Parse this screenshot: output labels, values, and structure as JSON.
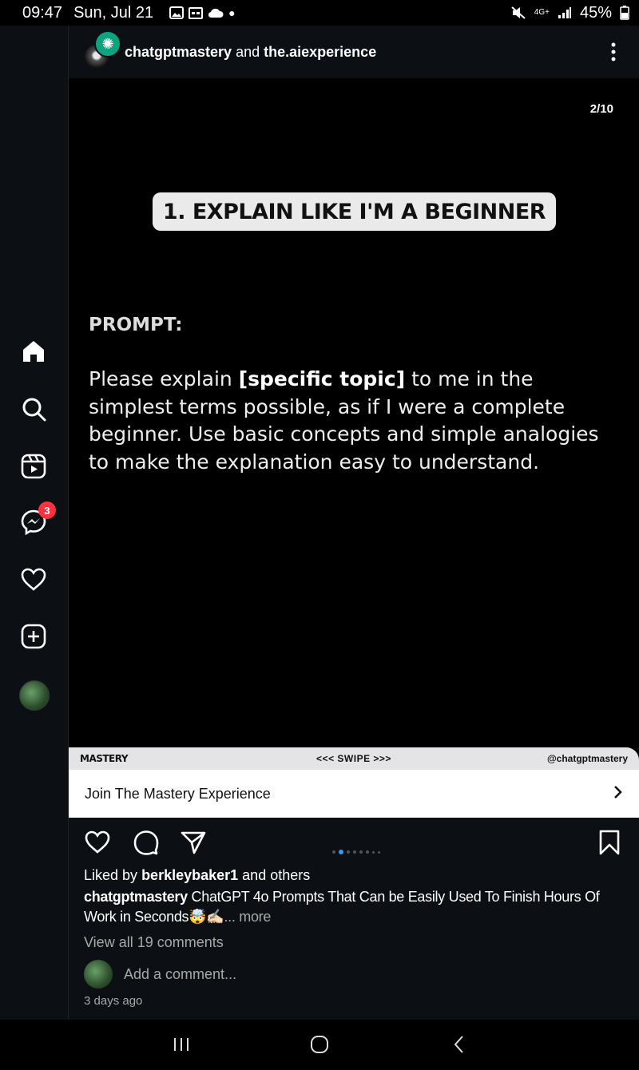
{
  "status_bar": {
    "time": "09:47",
    "date": "Sun, Jul 21",
    "network": "4G+",
    "battery": "45%"
  },
  "nav": {
    "items": [
      "home-icon",
      "search-icon",
      "reels-icon",
      "messenger-icon",
      "heart-icon",
      "create-icon",
      "profile-avatar"
    ],
    "messages_badge": "3"
  },
  "post": {
    "author_primary": "chatgptmastery",
    "joiner": "and",
    "author_secondary": "the.aiexperience",
    "slide_counter": "2/10",
    "slide_heading": "1. EXPLAIN LIKE I'M A BEGINNER",
    "prompt_label": "PROMPT:",
    "prompt_text_before": "Please explain ",
    "prompt_placeholder": "[specific topic]",
    "prompt_text_after": " to me in the simplest terms possible, as if I were a complete beginner. Use basic concepts and simple analogies to make the explanation easy to understand.",
    "footer_left": "MASTERY",
    "footer_center": "<<< SWIPE >>>",
    "footer_right": "@chatgptmastery",
    "cta_label": "Join The Mastery Experience",
    "liked_by_prefix": "Liked by",
    "liked_by_user": "berkleybaker1",
    "liked_by_suffix": "and others",
    "caption_user": "chatgptmastery",
    "caption_text": "ChatGPT 4o Prompts That Can be Easily Used To Finish Hours Of Work in Seconds🤯✍🏻",
    "caption_more": "... more",
    "view_comments": "View all 19 comments",
    "comment_placeholder": "Add a comment...",
    "timestamp": "3 days ago"
  },
  "colors": {
    "background": "#000000",
    "panel": "#0c0f14",
    "badge": "#ff3040",
    "carousel_active_dot": "#3897f0"
  }
}
